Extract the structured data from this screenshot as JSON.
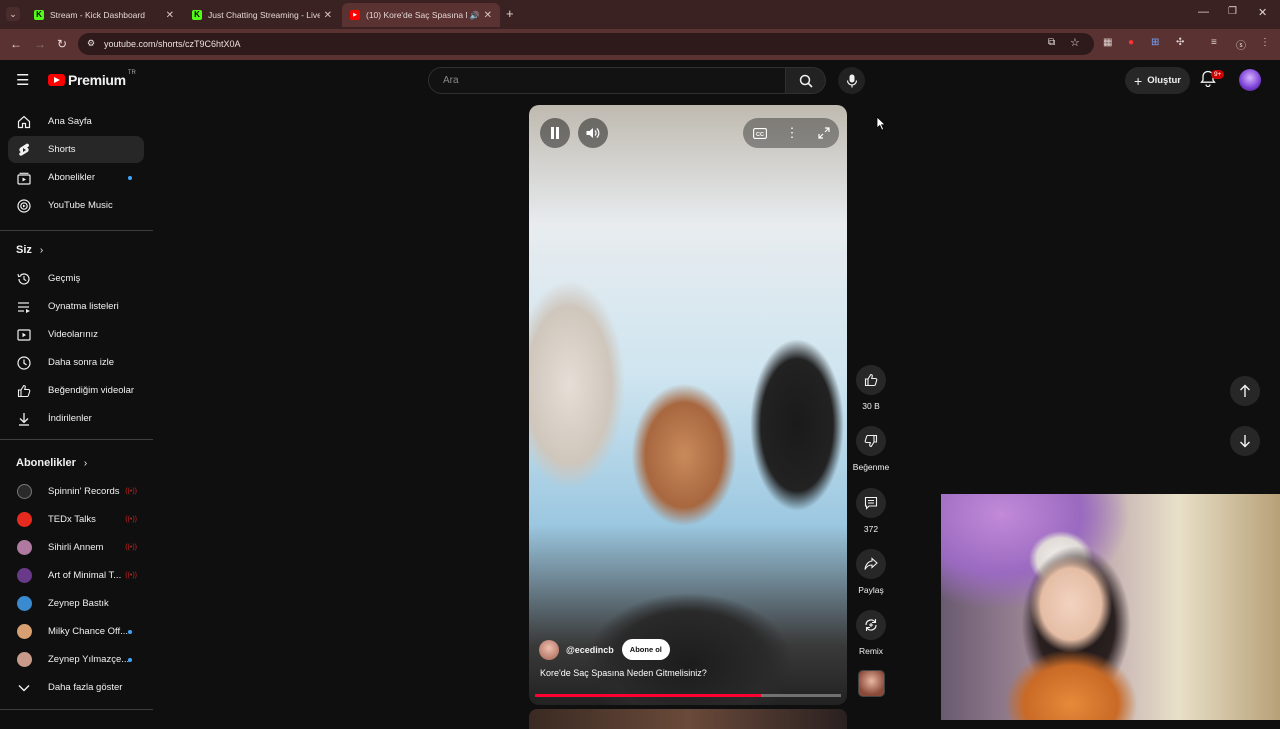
{
  "browser": {
    "tabs": [
      {
        "title": "Stream - Kick Dashboard",
        "favicon_color": "#53fc18",
        "favicon_letter": "K"
      },
      {
        "title": "Just Chatting Streaming - Live",
        "favicon_color": "#53fc18",
        "favicon_letter": "K"
      },
      {
        "title": "(10) Kore'de Saç Spasına Ne",
        "favicon_color": "#ff0000",
        "favicon_letter": "▶"
      }
    ],
    "url": "youtube.com/shorts/czT9C6htX0A"
  },
  "masthead": {
    "logo_text": "Premium",
    "country": "TR",
    "search_placeholder": "Ara",
    "create_label": "Oluştur",
    "notification_count": "9+"
  },
  "sidebar": {
    "main": [
      {
        "label": "Ana Sayfa",
        "icon": "home-icon"
      },
      {
        "label": "Shorts",
        "icon": "shorts-icon",
        "active": true
      },
      {
        "label": "Abonelikler",
        "icon": "subscriptions-icon",
        "dot": true
      },
      {
        "label": "YouTube Music",
        "icon": "music-icon"
      }
    ],
    "you_heading": "Siz",
    "you": [
      {
        "label": "Geçmiş",
        "icon": "history-icon"
      },
      {
        "label": "Oynatma listeleri",
        "icon": "playlists-icon"
      },
      {
        "label": "Videolarınız",
        "icon": "your-videos-icon"
      },
      {
        "label": "Daha sonra izle",
        "icon": "watch-later-icon"
      },
      {
        "label": "Beğendiğim videolar",
        "icon": "liked-icon"
      },
      {
        "label": "İndirilenler",
        "icon": "download-icon"
      }
    ],
    "subs_heading": "Abonelikler",
    "subs": [
      {
        "label": "Spinnin' Records",
        "color": "#2a2a2a",
        "live": true
      },
      {
        "label": "TEDx Talks",
        "color": "#e62b1e",
        "live": true
      },
      {
        "label": "Sihirli Annem",
        "color": "#b07aa0",
        "live": true
      },
      {
        "label": "Art of Minimal T...",
        "color": "#6a3a8a",
        "live": true
      },
      {
        "label": "Zeynep Bastık",
        "color": "#3a8ad0",
        "live": false
      },
      {
        "label": "Milky Chance Off...",
        "color": "#d8a070",
        "dot": true
      },
      {
        "label": "Zeynep Yılmazçe...",
        "color": "#c89a8a",
        "dot": true
      }
    ],
    "show_more": "Daha fazla göster"
  },
  "short": {
    "channel_handle": "@ecedincb",
    "subscribe_label": "Abone ol",
    "title": "Kore'de Saç Spasına Neden Gitmelisiniz?",
    "progress": 0.74
  },
  "actions": {
    "like_count": "30 B",
    "dislike_label": "Beğenme",
    "comment_count": "372",
    "share_label": "Paylaş",
    "remix_label": "Remix"
  },
  "colors": {
    "accent": "#ff0000",
    "progress": "#ff0033",
    "link_dot": "#3ea6ff"
  }
}
